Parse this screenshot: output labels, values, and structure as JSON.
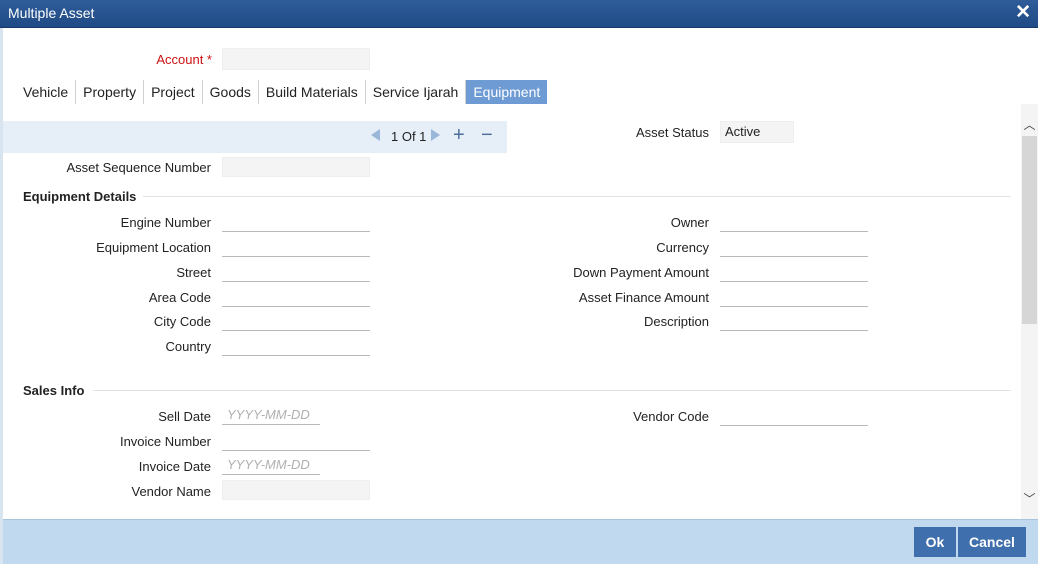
{
  "window": {
    "title": "Multiple Asset"
  },
  "account": {
    "label": "Account *",
    "value": ""
  },
  "tabs": [
    "Vehicle",
    "Property",
    "Project",
    "Goods",
    "Build Materials",
    "Service Ijarah",
    "Equipment"
  ],
  "active_tab": "Equipment",
  "navigator": {
    "count": "1 Of 1"
  },
  "asset_status": {
    "label": "Asset Status",
    "value": "Active"
  },
  "asset_sequence": {
    "label": "Asset Sequence Number",
    "value": ""
  },
  "equipment_details": {
    "title": "Equipment Details",
    "left": [
      "Engine Number",
      "Equipment Location",
      "Street",
      "Area Code",
      "City Code",
      "Country"
    ],
    "right": [
      "Owner",
      "Currency",
      "Down Payment Amount",
      "Asset Finance Amount",
      "Description"
    ]
  },
  "sales_info": {
    "title": "Sales Info",
    "sell_date": {
      "label": "Sell Date",
      "placeholder": "YYYY-MM-DD"
    },
    "invoice_number": {
      "label": "Invoice Number"
    },
    "invoice_date": {
      "label": "Invoice Date",
      "placeholder": "YYYY-MM-DD"
    },
    "vendor_name": {
      "label": "Vendor Name"
    },
    "vendor_code": {
      "label": "Vendor Code"
    }
  },
  "buttons": {
    "ok": "Ok",
    "cancel": "Cancel"
  },
  "colors": {
    "titlebar": "#2a5591",
    "active_tab": "#6e9bd3",
    "footer": "#c1d9ee",
    "button": "#3f70ad",
    "required": "#cc1111"
  }
}
